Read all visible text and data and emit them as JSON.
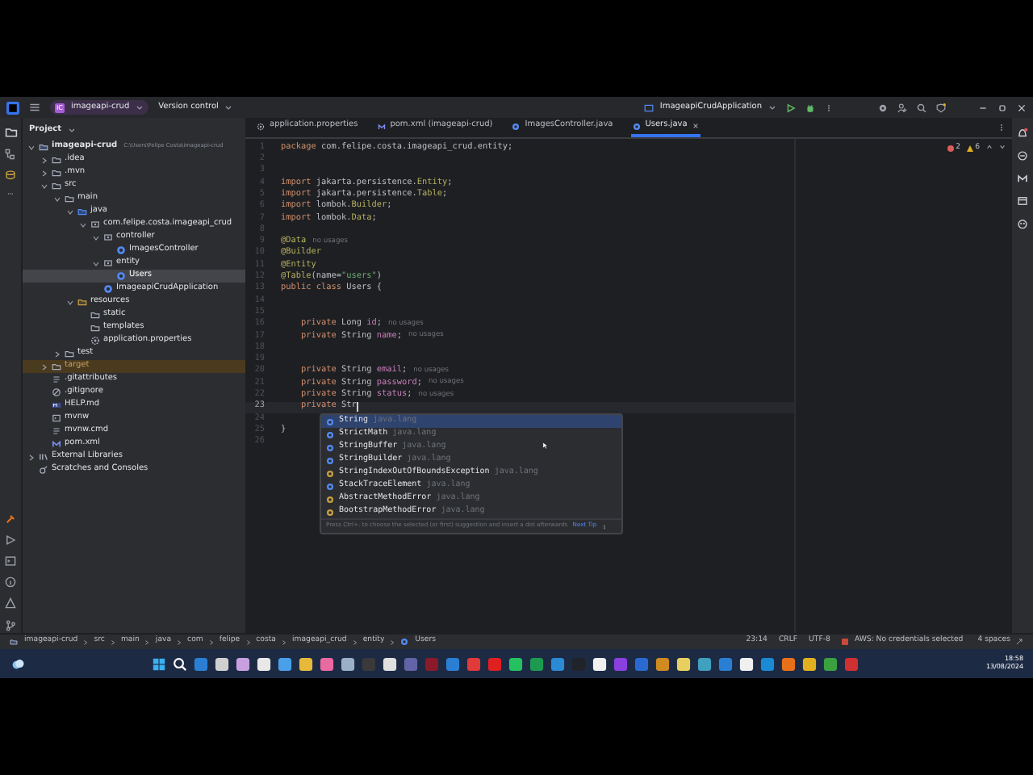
{
  "titlebar": {
    "project_badge": "IC",
    "project": "imageapi-crud",
    "vcs": "Version control",
    "run_config": "ImageapiCrudApplication"
  },
  "project_panel": {
    "title": "Project",
    "tree": [
      {
        "label": "imageapi-crud",
        "path": "C:\\Users\\Felipe Costa\\imageapi-crud",
        "kind": "module",
        "selected": false,
        "excluded": false,
        "expanded": true,
        "children": [
          {
            "label": ".idea",
            "kind": "folder",
            "selected": false,
            "excluded": false,
            "expanded": false
          },
          {
            "label": ".mvn",
            "kind": "folder",
            "selected": false,
            "excluded": false,
            "expanded": false
          },
          {
            "label": "src",
            "kind": "folder",
            "selected": false,
            "excluded": false,
            "expanded": true,
            "children": [
              {
                "label": "main",
                "kind": "folder",
                "selected": false,
                "excluded": false,
                "expanded": true,
                "children": [
                  {
                    "label": "java",
                    "kind": "source",
                    "selected": false,
                    "excluded": false,
                    "expanded": true,
                    "children": [
                      {
                        "label": "com.felipe.costa.imageapi_crud",
                        "kind": "package",
                        "selected": false,
                        "excluded": false,
                        "expanded": true,
                        "children": [
                          {
                            "label": "controller",
                            "kind": "package",
                            "selected": false,
                            "excluded": false,
                            "expanded": true,
                            "children": [
                              {
                                "label": "ImagesController",
                                "kind": "class",
                                "selected": false,
                                "excluded": false
                              }
                            ]
                          },
                          {
                            "label": "entity",
                            "kind": "package",
                            "selected": false,
                            "excluded": false,
                            "expanded": true,
                            "children": [
                              {
                                "label": "Users",
                                "kind": "class",
                                "selected": true,
                                "excluded": false
                              }
                            ]
                          },
                          {
                            "label": "ImageapiCrudApplication",
                            "kind": "class",
                            "selected": false,
                            "excluded": false
                          }
                        ]
                      }
                    ]
                  },
                  {
                    "label": "resources",
                    "kind": "resources",
                    "selected": false,
                    "excluded": false,
                    "expanded": true,
                    "children": [
                      {
                        "label": "static",
                        "kind": "folder",
                        "selected": false,
                        "excluded": false
                      },
                      {
                        "label": "templates",
                        "kind": "folder",
                        "selected": false,
                        "excluded": false
                      },
                      {
                        "label": "application.properties",
                        "kind": "properties",
                        "selected": false,
                        "excluded": false
                      }
                    ]
                  }
                ]
              },
              {
                "label": "test",
                "kind": "folder",
                "selected": false,
                "excluded": false,
                "expanded": false
              }
            ]
          },
          {
            "label": "target",
            "kind": "folder",
            "selected": false,
            "excluded": true,
            "expanded": false
          },
          {
            "label": ".gitattributes",
            "kind": "text",
            "selected": false,
            "excluded": false
          },
          {
            "label": ".gitignore",
            "kind": "ignore",
            "selected": false,
            "excluded": false
          },
          {
            "label": "HELP.md",
            "kind": "markdown",
            "selected": false,
            "excluded": false
          },
          {
            "label": "mvnw",
            "kind": "script",
            "selected": false,
            "excluded": false
          },
          {
            "label": "mvnw.cmd",
            "kind": "text",
            "selected": false,
            "excluded": false
          },
          {
            "label": "pom.xml",
            "kind": "maven",
            "selected": false,
            "excluded": false
          }
        ]
      },
      {
        "label": "External Libraries",
        "kind": "library",
        "selected": false,
        "excluded": false,
        "expanded": false
      },
      {
        "label": "Scratches and Consoles",
        "kind": "scratch",
        "selected": false,
        "excluded": false
      }
    ]
  },
  "tabs": [
    {
      "label": "application.properties",
      "kind": "properties",
      "selected": false
    },
    {
      "label": "pom.xml (imageapi-crud)",
      "kind": "maven",
      "selected": false
    },
    {
      "label": "ImagesController.java",
      "kind": "class",
      "selected": false
    },
    {
      "label": "Users.java",
      "kind": "class",
      "selected": true
    }
  ],
  "inspections": {
    "errors": "2",
    "warnings": "6"
  },
  "code": [
    {
      "number": "1",
      "segments": [
        {
          "kind": "kw",
          "text": "package"
        },
        {
          "kind": "text",
          "text": " com.felipe.costa.imageapi_crud.entity;"
        }
      ]
    },
    {
      "number": "2"
    },
    {
      "number": "3"
    },
    {
      "number": "4",
      "segments": [
        {
          "kind": "kw",
          "text": "import"
        },
        {
          "kind": "text",
          "text": " jakarta.persistence."
        },
        {
          "kind": "ann",
          "text": "Entity"
        },
        {
          "kind": "text",
          "text": ";"
        }
      ]
    },
    {
      "number": "5",
      "segments": [
        {
          "kind": "kw",
          "text": "import"
        },
        {
          "kind": "text",
          "text": " jakarta.persistence."
        },
        {
          "kind": "ann",
          "text": "Table"
        },
        {
          "kind": "text",
          "text": ";"
        }
      ]
    },
    {
      "number": "6",
      "segments": [
        {
          "kind": "kw",
          "text": "import"
        },
        {
          "kind": "text",
          "text": " lombok."
        },
        {
          "kind": "ann",
          "text": "Builder"
        },
        {
          "kind": "text",
          "text": ";"
        }
      ]
    },
    {
      "number": "7",
      "segments": [
        {
          "kind": "kw",
          "text": "import"
        },
        {
          "kind": "text",
          "text": " lombok."
        },
        {
          "kind": "ann",
          "text": "Data"
        },
        {
          "kind": "text",
          "text": ";"
        }
      ]
    },
    {
      "number": "8"
    },
    {
      "number": "9",
      "segments": [
        {
          "kind": "ann",
          "text": "@Data"
        },
        {
          "kind": "hint",
          "text": "no usages"
        }
      ]
    },
    {
      "number": "10",
      "segments": [
        {
          "kind": "ann",
          "text": "@Builder"
        }
      ]
    },
    {
      "number": "11",
      "segments": [
        {
          "kind": "ann",
          "text": "@Entity"
        }
      ]
    },
    {
      "number": "12",
      "segments": [
        {
          "kind": "ann",
          "text": "@Table"
        },
        {
          "kind": "text",
          "text": "(name="
        },
        {
          "kind": "str",
          "text": "\"users\""
        },
        {
          "kind": "text",
          "text": ")"
        }
      ]
    },
    {
      "number": "13",
      "segments": [
        {
          "kind": "kw",
          "text": "public class"
        },
        {
          "kind": "text",
          "text": " Users {"
        }
      ]
    },
    {
      "number": "14"
    },
    {
      "number": "15"
    },
    {
      "number": "16",
      "segments": [
        {
          "kind": "kw",
          "text": "    private"
        },
        {
          "kind": "text",
          "text": " Long "
        },
        {
          "kind": "field",
          "text": "id"
        },
        {
          "kind": "text",
          "text": ";"
        },
        {
          "kind": "hint",
          "text": "no usages"
        }
      ]
    },
    {
      "number": "17",
      "segments": [
        {
          "kind": "kw",
          "text": "    private"
        },
        {
          "kind": "text",
          "text": " String "
        },
        {
          "kind": "field",
          "text": "name"
        },
        {
          "kind": "text",
          "text": ";"
        },
        {
          "kind": "hint",
          "text": "no usages"
        }
      ]
    },
    {
      "number": "18"
    },
    {
      "number": "19"
    },
    {
      "number": "20",
      "segments": [
        {
          "kind": "kw",
          "text": "    private"
        },
        {
          "kind": "text",
          "text": " String "
        },
        {
          "kind": "field",
          "text": "email"
        },
        {
          "kind": "text",
          "text": ";"
        },
        {
          "kind": "hint",
          "text": "no usages"
        }
      ]
    },
    {
      "number": "21",
      "segments": [
        {
          "kind": "kw",
          "text": "    private"
        },
        {
          "kind": "text",
          "text": " String "
        },
        {
          "kind": "field",
          "text": "password"
        },
        {
          "kind": "text",
          "text": ";"
        },
        {
          "kind": "hint",
          "text": "no usages"
        }
      ]
    },
    {
      "number": "22",
      "segments": [
        {
          "kind": "kw",
          "text": "    private"
        },
        {
          "kind": "text",
          "text": " String "
        },
        {
          "kind": "field",
          "text": "status"
        },
        {
          "kind": "text",
          "text": ";"
        },
        {
          "kind": "hint",
          "text": "no usages"
        }
      ]
    },
    {
      "number": "23",
      "current": true,
      "segments": [
        {
          "kind": "kw",
          "text": "    private"
        },
        {
          "kind": "text",
          "text": " Str"
        }
      ]
    },
    {
      "number": "24"
    },
    {
      "number": "25",
      "segments": [
        {
          "kind": "text",
          "text": "}"
        }
      ]
    },
    {
      "number": "26"
    }
  ],
  "completion": {
    "items": [
      {
        "name": "String",
        "package": "java.lang",
        "kind": "class",
        "selected": true
      },
      {
        "name": "StrictMath",
        "package": "java.lang",
        "kind": "class",
        "selected": false
      },
      {
        "name": "StringBuffer",
        "package": "java.lang",
        "kind": "class",
        "selected": false
      },
      {
        "name": "StringBuilder",
        "package": "java.lang",
        "kind": "class",
        "selected": false
      },
      {
        "name": "StringIndexOutOfBoundsException",
        "package": "java.lang",
        "kind": "exception",
        "selected": false
      },
      {
        "name": "StackTraceElement",
        "package": "java.lang",
        "kind": "class",
        "selected": false
      },
      {
        "name": "AbstractMethodError",
        "package": "java.lang",
        "kind": "exception",
        "selected": false
      },
      {
        "name": "BootstrapMethodError",
        "package": "java.lang",
        "kind": "exception",
        "selected": false
      }
    ],
    "hint": "Press Ctrl+. to choose the selected (or first) suggestion and insert a dot afterwards",
    "next_tip": "Next Tip"
  },
  "breadcrumbs": [
    "imageapi-crud",
    "src",
    "main",
    "java",
    "com",
    "felipe",
    "costa",
    "imageapi_crud",
    "entity",
    "Users"
  ],
  "status_bar": {
    "position": "23:14",
    "line_ending": "CRLF",
    "encoding": "UTF-8",
    "aws": "AWS: No credentials selected",
    "indent": "4 spaces"
  },
  "taskbar": {
    "apps": [
      {
        "color": "#2a7fd4"
      },
      {
        "color": "#d0d0d0"
      },
      {
        "color": "#c8a0e0"
      },
      {
        "color": "#e8e8e8"
      },
      {
        "color": "#4aa0e8"
      },
      {
        "color": "#e8b83a"
      },
      {
        "color": "#e86aa0"
      },
      {
        "color": "#9ab0c8"
      },
      {
        "color": "#3a3a3a"
      },
      {
        "color": "#e0e0e0"
      },
      {
        "color": "#6264a7"
      },
      {
        "color": "#8a1a2a"
      },
      {
        "color": "#2a7fd4"
      },
      {
        "color": "#e03a3a"
      },
      {
        "color": "#e02020"
      },
      {
        "color": "#25c060"
      },
      {
        "color": "#1e9a50"
      },
      {
        "color": "#2a8ad4"
      },
      {
        "color": "#20242a"
      },
      {
        "color": "#f0f0f0"
      },
      {
        "color": "#8a40e0"
      },
      {
        "color": "#2a6ad0"
      },
      {
        "color": "#d08a20"
      },
      {
        "color": "#e8d060"
      },
      {
        "color": "#40a0c0"
      },
      {
        "color": "#2a7fd4"
      },
      {
        "color": "#f0f0f0"
      },
      {
        "color": "#1a8ad4"
      },
      {
        "color": "#e8701a"
      },
      {
        "color": "#e0b020"
      },
      {
        "color": "#3aa040"
      },
      {
        "color": "#d03030"
      }
    ],
    "time": "18:58",
    "date": "13/08/2024"
  }
}
